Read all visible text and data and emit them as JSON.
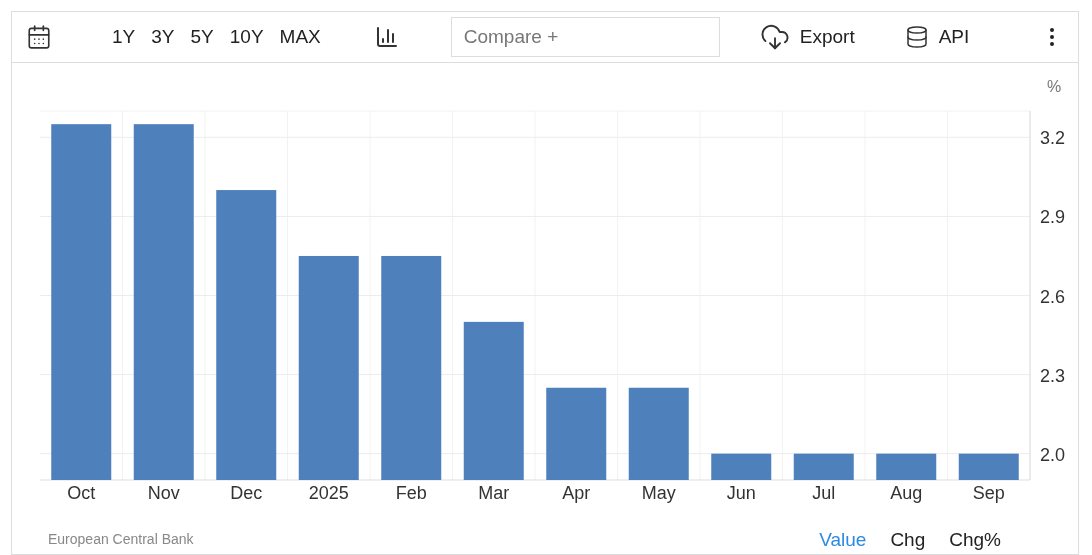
{
  "toolbar": {
    "ranges": [
      {
        "label": "1Y",
        "selected": false
      },
      {
        "label": "3Y",
        "selected": false
      },
      {
        "label": "5Y",
        "selected": false
      },
      {
        "label": "10Y",
        "selected": false
      },
      {
        "label": "MAX",
        "selected": false
      }
    ],
    "compare": {
      "placeholder": "Compare +"
    },
    "export": "Export",
    "api": "API"
  },
  "chart": {
    "unit": "%",
    "chart_data": {
      "type": "bar",
      "categories": [
        "Oct",
        "Nov",
        "Dec",
        "2025",
        "Feb",
        "Mar",
        "Apr",
        "May",
        "Jun",
        "Jul",
        "Aug",
        "Sep"
      ],
      "grid": true,
      "series": [
        {
          "color": "#4e80bc",
          "values": [
            3.25,
            3.25,
            3.0,
            2.75,
            2.75,
            2.5,
            2.25,
            2.25,
            2.0,
            2.0,
            2.0,
            2.0
          ]
        }
      ],
      "ylim": [
        1.9,
        3.3
      ],
      "yticks": [
        {
          "value": 2.0,
          "label": "2.0"
        },
        {
          "value": 2.3,
          "label": "2.3"
        },
        {
          "value": 2.6,
          "label": "2.6"
        },
        {
          "value": 2.9,
          "label": "2.9"
        },
        {
          "value": 3.2,
          "label": "3.2"
        }
      ]
    }
  },
  "footer": {
    "source": "European Central Bank",
    "modes": [
      {
        "label": "Value",
        "selected": true
      },
      {
        "label": "Chg",
        "selected": false
      },
      {
        "label": "Chg%",
        "selected": false
      }
    ]
  }
}
